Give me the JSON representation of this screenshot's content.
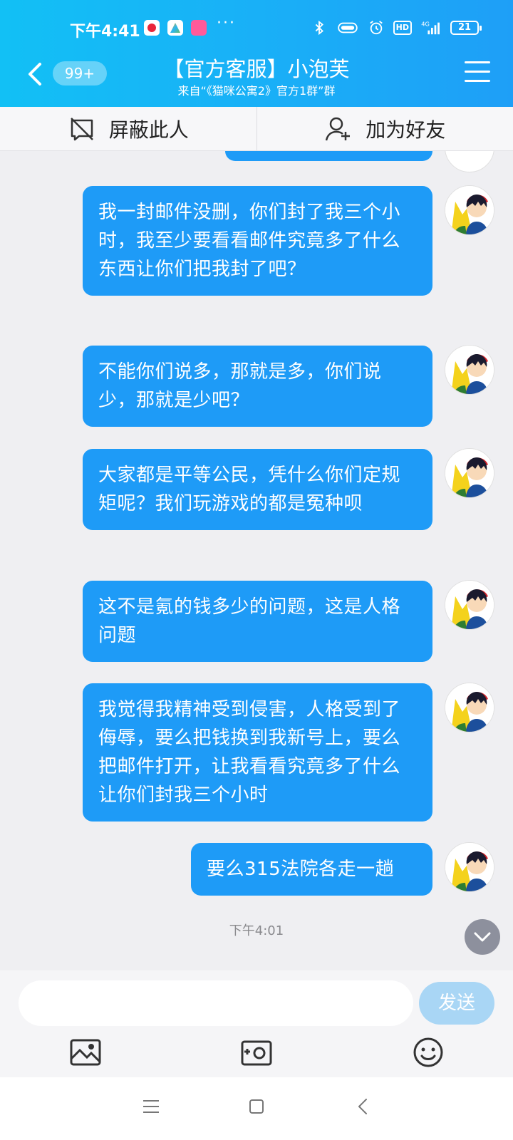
{
  "status_bar": {
    "time": "下午4:41",
    "battery": "21",
    "network": "4G",
    "hd": "HD",
    "more": "···"
  },
  "header": {
    "unread_count": "99+",
    "title": "【官方客服】小泡芙",
    "subtitle": "来自“《猫咪公寓2》官方1群”群"
  },
  "actions": {
    "block": "屏蔽此人",
    "add_friend": "加为好友"
  },
  "messages": [
    {
      "text": "我一封邮件没删，你们封了我三个小时，我至少要看看邮件究竟多了什么东西让你们把我封了吧？"
    },
    {
      "text": "不能你们说多，那就是多，你们说少，那就是少吧？"
    },
    {
      "text": "大家都是平等公民，凭什么你们定规矩呢？我们玩游戏的都是冤种呗"
    },
    {
      "text": "这不是氪的钱多少的问题，这是人格问题"
    },
    {
      "text": "我觉得我精神受到侵害，人格受到了侮辱，要么把钱换到我新号上，要么把邮件打开，让我看看究竟多了什么让你们封我三个小时"
    },
    {
      "text": "要么315法院各走一趟"
    }
  ],
  "timestamp": "下午4:01",
  "input": {
    "value": "",
    "send_label": "发送"
  },
  "colors": {
    "header_start": "#12c0f5",
    "header_end": "#1e9ff7",
    "bubble": "#1e9bf7",
    "send_disabled": "#a9d6f5"
  },
  "icons": [
    "back-icon",
    "menu-icon",
    "block-icon",
    "add-friend-icon",
    "image-icon",
    "camera-icon",
    "emoji-icon",
    "chevron-down-icon"
  ]
}
